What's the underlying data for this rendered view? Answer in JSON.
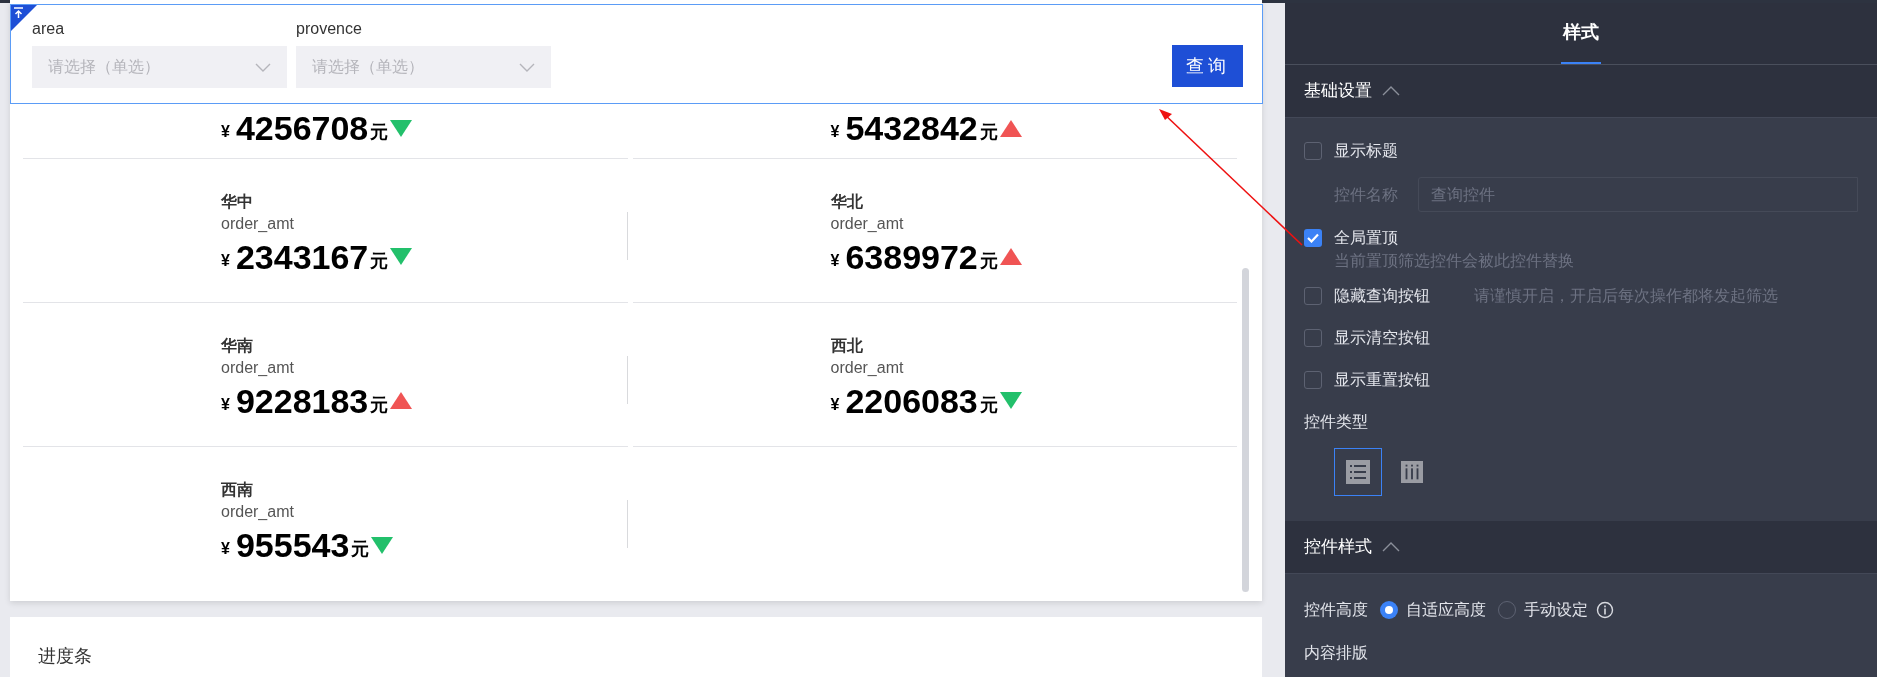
{
  "filter_bar": {
    "pinned": true,
    "filters": [
      {
        "label": "area",
        "placeholder": "请选择（单选）"
      },
      {
        "label": "provence",
        "placeholder": "请选择（单选）"
      }
    ],
    "query_button": "查询"
  },
  "cards": [
    {
      "currency": "¥",
      "value": "4256708",
      "unit": "元",
      "rising": false
    },
    {
      "currency": "¥",
      "value": "5432842",
      "unit": "元",
      "rising": true
    },
    {
      "name": "华中",
      "metric": "order_amt",
      "currency": "¥",
      "value": "2343167",
      "unit": "元",
      "rising": false
    },
    {
      "name": "华北",
      "metric": "order_amt",
      "currency": "¥",
      "value": "6389972",
      "unit": "元",
      "rising": true
    },
    {
      "name": "华南",
      "metric": "order_amt",
      "currency": "¥",
      "value": "9228183",
      "unit": "元",
      "rising": true
    },
    {
      "name": "西北",
      "metric": "order_amt",
      "currency": "¥",
      "value": "2206083",
      "unit": "元",
      "rising": false
    },
    {
      "name": "西南",
      "metric": "order_amt",
      "currency": "¥",
      "value": "955543",
      "unit": "元",
      "rising": false
    }
  ],
  "next_card": {
    "title": "进度条"
  },
  "panel": {
    "tabs": [
      {
        "label": "样式",
        "selected": true
      }
    ],
    "sections": [
      {
        "title": "基础设置",
        "expanded": true,
        "items": [
          {
            "kind": "checkbox",
            "label": "显示标题",
            "checked": false
          },
          {
            "kind": "field",
            "label": "控件名称",
            "placeholder": "查询控件",
            "disabled": true
          },
          {
            "kind": "checkbox",
            "label": "全局置顶",
            "checked": true,
            "hint": "当前置顶筛选控件会被此控件替换"
          },
          {
            "kind": "checkbox",
            "label": "隐藏查询按钮",
            "checked": false,
            "note": "请谨慎开启，开启后每次操作都将发起筛选"
          },
          {
            "kind": "checkbox",
            "label": "显示清空按钮",
            "checked": false
          },
          {
            "kind": "checkbox",
            "label": "显示重置按钮",
            "checked": false
          },
          {
            "kind": "picker",
            "label": "控件类型",
            "options": [
              {
                "kind": "list",
                "selected": true
              },
              {
                "kind": "columns",
                "selected": false
              }
            ]
          }
        ]
      },
      {
        "title": "控件样式",
        "expanded": true,
        "items": [
          {
            "kind": "radio",
            "label": "控件高度",
            "options": [
              {
                "label": "自适应高度",
                "selected": true,
                "info": false
              },
              {
                "label": "手动设定",
                "selected": false,
                "info": true
              }
            ]
          },
          {
            "kind": "heading",
            "label": "内容排版"
          }
        ]
      }
    ]
  }
}
